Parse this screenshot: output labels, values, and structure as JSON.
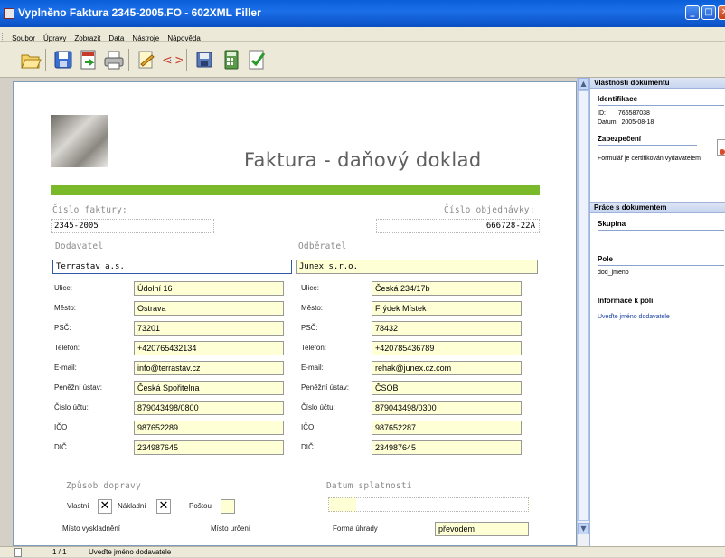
{
  "window": {
    "title": "Vyplněno Faktura 2345-2005.FO - 602XML Filler"
  },
  "menu": [
    "Soubor",
    "Úpravy",
    "Zobrazit",
    "Data",
    "Nástroje",
    "Nápověda"
  ],
  "toolbar_icons": [
    "open-folder-icon",
    "save-icon",
    "export-pdf-icon",
    "print-icon",
    "sign-icon",
    "xml-icon",
    "save-disk-icon",
    "calculator-icon",
    "check-form-icon"
  ],
  "document": {
    "title": "Faktura - daňový doklad",
    "invoice_no_label": "Číslo faktury:",
    "invoice_no": "2345-2005",
    "order_no_label": "Číslo objednávky:",
    "order_no": "666728-22A",
    "supplier_heading": "Dodavatel",
    "customer_heading": "Odběratel",
    "supplier": {
      "name": "Terrastav a.s.",
      "street_label": "Ulice:",
      "street": "Údolní 16",
      "city_label": "Město:",
      "city": "Ostrava",
      "zip_label": "PSČ:",
      "zip": "73201",
      "phone_label": "Telefon:",
      "phone": "+420765432134",
      "email_label": "E-mail:",
      "email": "info@terrastav.cz",
      "bank_label": "Peněžní ústav:",
      "bank": "Česká Spořitelna",
      "account_label": "Číslo účtu:",
      "account": "879043498/0800",
      "ico_label": "IČO",
      "ico": "987652289",
      "dic_label": "DIČ",
      "dic": "234987645"
    },
    "customer": {
      "name": "Junex s.r.o.",
      "street_label": "Ulice:",
      "street": "Česká 234/17b",
      "city_label": "Město:",
      "city": "Frýdek Místek",
      "zip_label": "PSČ:",
      "zip": "78432",
      "phone_label": "Telefon:",
      "phone": "+420785436789",
      "email_label": "E-mail:",
      "email": "rehak@junex.cz.com",
      "bank_label": "Peněžní ústav:",
      "bank": "ČSOB",
      "account_label": "Číslo účtu:",
      "account": "879043498/0300",
      "ico_label": "IČO",
      "ico": "987652287",
      "dic_label": "DIČ",
      "dic": "234987645"
    },
    "shipping_heading": "Způsob dopravy",
    "shipping": {
      "own_label": "Vlastní",
      "own": "✕",
      "freight_label": "Nákladní",
      "freight": "✕",
      "post_label": "Poštou",
      "post": ""
    },
    "due_heading": "Datum splatnosti",
    "dispatch_place_label": "Místo vyskladnění",
    "destination_label": "Místo určení",
    "payment_label": "Forma úhrady",
    "payment": "převodem"
  },
  "sidebar": {
    "header1": "Vlastnosti dokumentu",
    "identification": "Identifikace",
    "id_label": "ID:",
    "id": "766587038",
    "date_label": "Datum:",
    "date": "2005-08-18",
    "security": "Zabezpečení",
    "security_text": "Formulář je certifikován vydavatelem",
    "header2": "Práce s dokumentem",
    "group": "Skupina",
    "field": "Pole",
    "field_value": "dod_jmeno",
    "field_info": "Informace k poli",
    "field_info_text": "Uveďte jméno dodavatele"
  },
  "status": {
    "page": "1 / 1",
    "message": "Uveďte jméno dodavatele"
  },
  "colors": {
    "accent_green": "#7aba2a",
    "field_yellow": "#ffffd6",
    "titlebar_blue": "#0a5fd8"
  }
}
